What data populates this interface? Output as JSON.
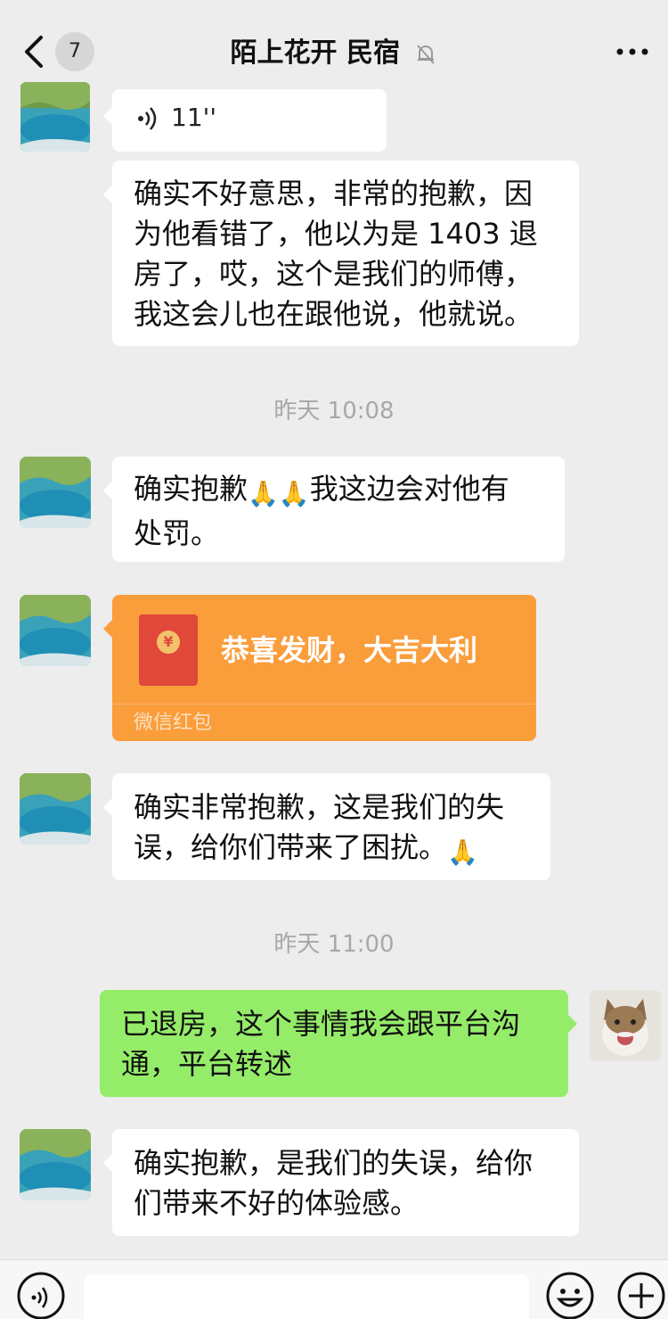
{
  "header": {
    "back_badge": "7",
    "title": "陌上花开 民宿"
  },
  "messages": [
    {
      "type": "voice",
      "sender": "other",
      "duration": "11''"
    },
    {
      "type": "text",
      "sender": "other",
      "lines": [
        "确实不好意思，非常的抱歉，因",
        "为他看错了，他以为是 1403 退",
        "房了，哎，这个是我们的师傅，",
        "我这会儿也在跟他说，他就说。"
      ]
    },
    {
      "type": "timestamp",
      "text": "昨天 10:08"
    },
    {
      "type": "text",
      "sender": "other",
      "line1_a": "确实抱歉",
      "emoji": "🙏🙏",
      "line1_b": "我这边会对他有",
      "line2": "处罚。"
    },
    {
      "type": "red_packet",
      "sender": "other",
      "greeting": "恭喜发财，大吉大利",
      "label": "微信红包",
      "seal": "¥"
    },
    {
      "type": "text",
      "sender": "other",
      "line1": "确实非常抱歉，这是我们的失",
      "line2_text": "误，给你们带来了困扰。",
      "emoji": "🙏"
    },
    {
      "type": "timestamp",
      "text": "昨天 11:00"
    },
    {
      "type": "text",
      "sender": "me",
      "lines": [
        "已退房，这个事情我会跟平台沟",
        "通，平台转述"
      ]
    },
    {
      "type": "text",
      "sender": "other",
      "lines": [
        "确实抱歉，是我们的失误，给你",
        "们带来不好的体验感。"
      ]
    }
  ],
  "icons": {
    "back": "chevron-left-icon",
    "mute": "bell-off-icon",
    "more": "more-dots-icon",
    "voice": "voice-wave-icon",
    "voice_input": "voice-input-icon",
    "emoji": "emoji-icon",
    "plus": "plus-icon"
  },
  "colors": {
    "background": "#ededed",
    "my_bubble": "#95ec69",
    "other_bubble": "#ffffff",
    "red_packet": "#fa9d3b",
    "timestamp_text": "#a8a8a8"
  }
}
